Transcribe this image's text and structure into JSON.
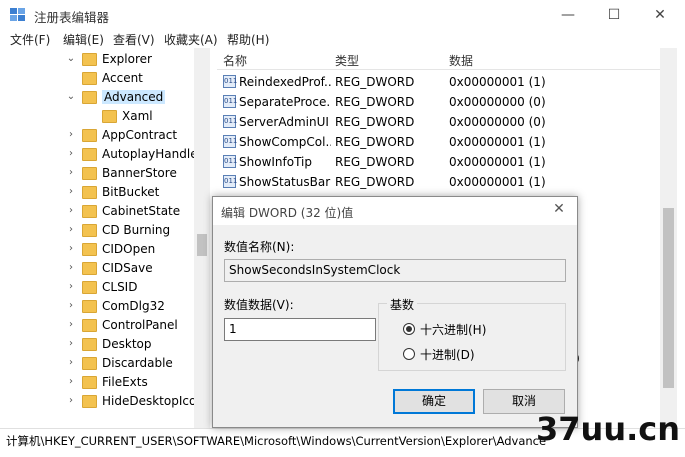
{
  "window": {
    "title": "注册表编辑器",
    "minimize": "—",
    "maximize": "☐",
    "close": "✕"
  },
  "menu": [
    "文件(F)",
    "编辑(E)",
    "查看(V)",
    "收藏夹(A)",
    "帮助(H)"
  ],
  "tree": {
    "items": [
      {
        "label": "Explorer",
        "arrow": "⌄"
      },
      {
        "label": "Accent",
        "arrow": ""
      },
      {
        "label": "Advanced",
        "arrow": "⌄"
      },
      {
        "label": "Xaml",
        "arrow": ""
      },
      {
        "label": "AppContract",
        "arrow": "›"
      },
      {
        "label": "AutoplayHandler",
        "arrow": "›"
      },
      {
        "label": "BannerStore",
        "arrow": "›"
      },
      {
        "label": "BitBucket",
        "arrow": "›"
      },
      {
        "label": "CabinetState",
        "arrow": "›"
      },
      {
        "label": "CD Burning",
        "arrow": "›"
      },
      {
        "label": "CIDOpen",
        "arrow": "›"
      },
      {
        "label": "CIDSave",
        "arrow": "›"
      },
      {
        "label": "CLSID",
        "arrow": "›"
      },
      {
        "label": "ComDlg32",
        "arrow": "›"
      },
      {
        "label": "ControlPanel",
        "arrow": "›"
      },
      {
        "label": "Desktop",
        "arrow": "›"
      },
      {
        "label": "Discardable",
        "arrow": "›"
      },
      {
        "label": "FileExts",
        "arrow": "›"
      },
      {
        "label": "HideDesktopIcon",
        "arrow": "›"
      }
    ],
    "selected_index": 2
  },
  "list": {
    "headers": {
      "name": "名称",
      "type": "类型",
      "data": "数据"
    },
    "rows": [
      {
        "name": "ReindexedProf...",
        "type": "REG_DWORD",
        "data": "0x00000001 (1)"
      },
      {
        "name": "SeparateProce...",
        "type": "REG_DWORD",
        "data": "0x00000000 (0)"
      },
      {
        "name": "ServerAdminUI",
        "type": "REG_DWORD",
        "data": "0x00000000 (0)"
      },
      {
        "name": "ShowCompCol...",
        "type": "REG_DWORD",
        "data": "0x00000001 (1)"
      },
      {
        "name": "ShowInfoTip",
        "type": "REG_DWORD",
        "data": "0x00000001 (1)"
      },
      {
        "name": "ShowStatusBar",
        "type": "REG_DWORD",
        "data": "0x00000001 (1)"
      }
    ],
    "partial_value": "0"
  },
  "statusbar": {
    "path": "计算机\\HKEY_CURRENT_USER\\SOFTWARE\\Microsoft\\Windows\\CurrentVersion\\Explorer\\Advanced"
  },
  "dialog": {
    "title": "编辑 DWORD (32 位)值",
    "close": "✕",
    "name_label": "数值名称(N):",
    "name_value": "ShowSecondsInSystemClock",
    "data_label": "数值数据(V):",
    "data_value": "1",
    "base_label": "基数",
    "radio_hex": "十六进制(H)",
    "radio_dec": "十进制(D)",
    "hex_checked": true,
    "ok": "确定",
    "cancel": "取消"
  },
  "watermark": "37uu.cn",
  "colors": {
    "folder": "#f3c24f",
    "selection": "#cce8ff",
    "accent": "#0078d7"
  }
}
